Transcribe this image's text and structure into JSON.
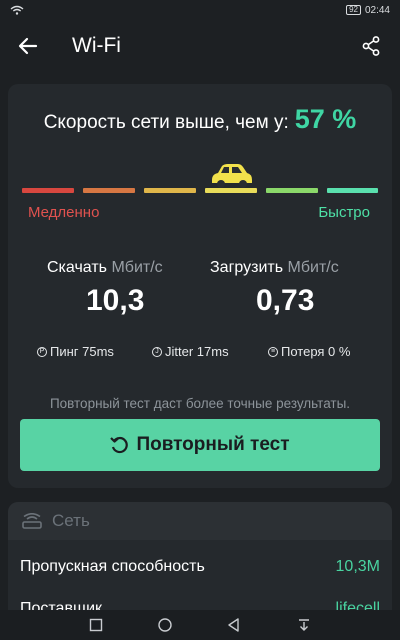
{
  "status_bar": {
    "battery": "92",
    "time": "02:44",
    "wifi_icon": "wifi-icon"
  },
  "app_bar": {
    "title": "Wi-Fi",
    "back_icon": "back-arrow-icon",
    "share_icon": "share-icon"
  },
  "result": {
    "headline": "Скорость сети выше, чем у:",
    "percent": "57 %",
    "gauge_colors": [
      "#d8473f",
      "#d77743",
      "#e0b64a",
      "#e9dc5a",
      "#8bd86a",
      "#5ae0ae"
    ],
    "slow_label": "Медленно",
    "fast_label": "Быстро"
  },
  "metrics": {
    "download": {
      "label": "Скачать",
      "unit": "Мбит/с",
      "value": "10,3"
    },
    "upload": {
      "label": "Загрузить",
      "unit": "Мбит/с",
      "value": "0,73"
    }
  },
  "stats": {
    "ping": "Пинг 75ms",
    "jitter": "Jitter 17ms",
    "loss": "Потеря 0 %"
  },
  "retest": {
    "hint": "Повторный тест даст более точные результаты.",
    "button_label": "Повторный тест"
  },
  "network": {
    "title": "Сеть",
    "rows": [
      {
        "label": "Пропускная способность",
        "value": "10,3M"
      },
      {
        "label": "Поставщик",
        "value": "lifecell"
      }
    ]
  },
  "colors": {
    "accent": "#3fd6a4",
    "button": "#58d3a4",
    "slow": "#e0524f",
    "fast": "#4ee0a6"
  }
}
